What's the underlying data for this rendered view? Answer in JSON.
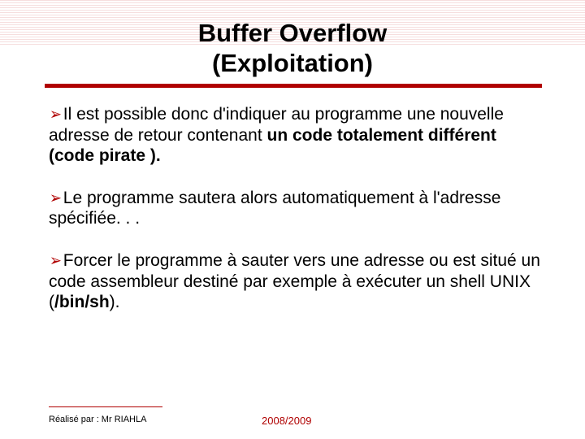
{
  "title": {
    "line1": "Buffer Overflow",
    "line2": "(Exploitation)"
  },
  "bullets": {
    "b1_pre": "Il est possible donc d'indiquer au programme une nouvelle adresse de retour contenant ",
    "b1_bold": "un code totalement différent (code pirate ).",
    "b2": "Le programme sautera alors automatiquement à l'adresse spécifiée. . .",
    "b3_pre": "Forcer le programme à sauter vers une adresse ou est situé un code assembleur destiné par exemple à exécuter un shell UNIX (",
    "b3_bold": "/bin/sh",
    "b3_post": ")."
  },
  "footer": {
    "author": "Réalisé par :  Mr RIAHLA",
    "year": "2008/2009"
  },
  "glyphs": {
    "arrow": "➢"
  }
}
